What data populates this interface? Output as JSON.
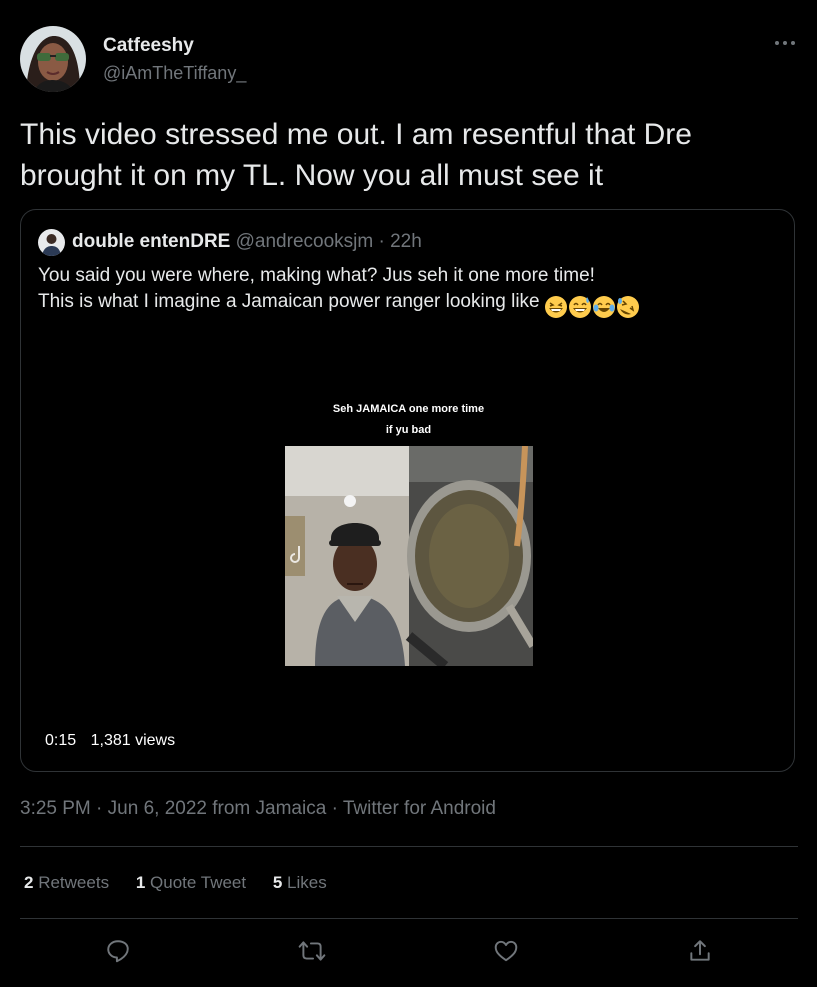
{
  "tweet": {
    "author": {
      "name": "Catfeeshy",
      "handle": "@iAmTheTiffany_"
    },
    "text": "This video stressed me out. I am resentful that Dre brought it on my TL. Now you all must see it",
    "more_icon": "more-horizontal-icon"
  },
  "quote": {
    "author": {
      "name": "double entenDRE",
      "handle": "@andrecooksjm",
      "time": "· 22h"
    },
    "text_line1": "You said you were where, making what? Jus seh it one more time!",
    "text_line2": "This is what I imagine a Jamaican power ranger looking like",
    "emojis": [
      "grinning-squinting-face",
      "grinning-face-with-sweat",
      "face-with-tears-of-joy",
      "rolling-on-floor-laughing"
    ],
    "video": {
      "caption_line1": "Seh JAMAICA one more time",
      "caption_line2": "if yu bad",
      "duration": "0:15",
      "views": "1,381 views"
    }
  },
  "meta": {
    "time": "3:25 PM",
    "date": "Jun 6, 2022",
    "location_prefix": "from",
    "location": "Jamaica",
    "client": "Twitter for Android",
    "sep": "·"
  },
  "stats": {
    "retweets_count": "2",
    "retweets_label": "Retweets",
    "quotes_count": "1",
    "quotes_label": "Quote Tweet",
    "likes_count": "5",
    "likes_label": "Likes"
  },
  "actions": [
    "reply-icon",
    "retweet-icon",
    "like-icon",
    "share-icon"
  ],
  "colors": {
    "background": "#000000",
    "text_primary": "#e7e9ea",
    "text_secondary": "#71767b",
    "border": "#2f3336"
  }
}
